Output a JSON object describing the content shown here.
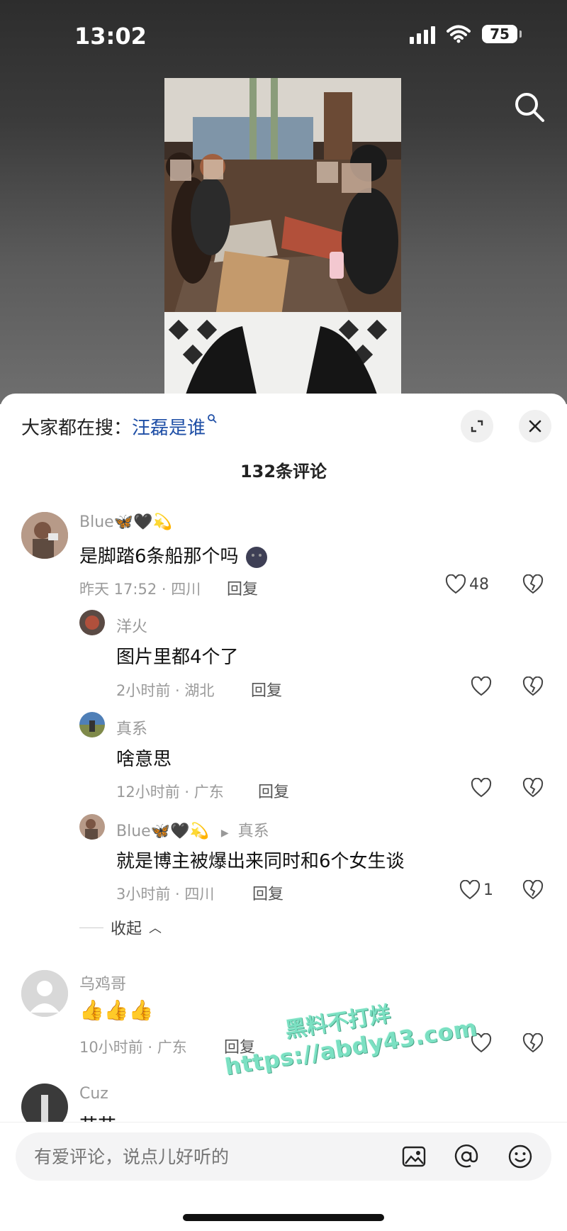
{
  "status_bar": {
    "time": "13:02",
    "battery": "75"
  },
  "header": {
    "search_icon": "search-icon"
  },
  "comments_sheet": {
    "hot_search_label": "大家都在搜：",
    "hot_search_keyword": "汪磊是谁",
    "count_label": "132条评论",
    "collapse_label": "收起",
    "comments": [
      {
        "user": "Blue🦋🖤💫",
        "text": "是脚踏6条船那个吗",
        "meta": "昨天 17:52 · 四川",
        "reply_label": "回复",
        "likes": "48",
        "replies": [
          {
            "user": "洋火",
            "text": "图片里都4个了",
            "meta": "2小时前 · 湖北",
            "reply_label": "回复",
            "likes": ""
          },
          {
            "user": "真系",
            "text": "啥意思",
            "meta": "12小时前 · 广东",
            "reply_label": "回复",
            "likes": ""
          },
          {
            "user": "Blue🦋🖤💫",
            "reply_to": "真系",
            "text": "就是博主被爆出来同时和6个女生谈",
            "meta": "3小时前 · 四川",
            "reply_label": "回复",
            "likes": "1"
          }
        ]
      },
      {
        "user": "乌鸡哥",
        "text": "👍👍👍",
        "meta": "10小时前 · 广东",
        "reply_label": "回复",
        "likes": ""
      },
      {
        "user": "Cuz",
        "text": "艹艹"
      }
    ]
  },
  "watermark": {
    "line1": "黑料不打烊",
    "line2": "https://abdy43.com"
  },
  "input_bar": {
    "placeholder": "有爱评论，说点儿好听的"
  }
}
